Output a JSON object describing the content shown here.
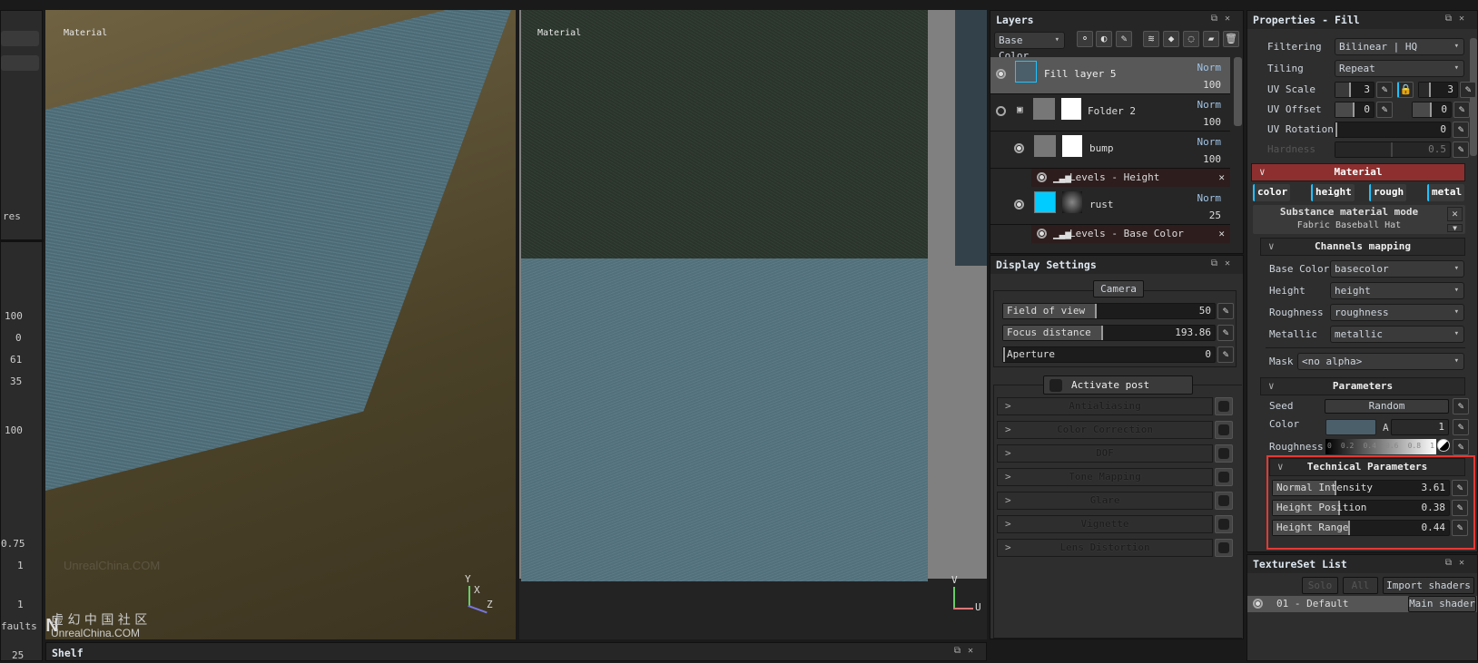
{
  "viewport3d": {
    "label": "Material",
    "watermark": "UnrealChina.COM",
    "axes": [
      "Y",
      "X",
      "Z"
    ]
  },
  "viewport2d": {
    "label": "Material",
    "axes": [
      "V",
      "U"
    ]
  },
  "branding": {
    "logo_text": "UECN",
    "chinese": "虚 幻 中 国 社 区",
    "site": "UnrealChina.COM"
  },
  "shelf": {
    "title": "Shelf"
  },
  "left_panel": {
    "values": [
      "100",
      "0",
      "61",
      "35",
      "100",
      "0.75",
      "1",
      "1",
      "25"
    ],
    "texts": [
      "res",
      "faults"
    ]
  },
  "layers": {
    "title": "Layers",
    "channel": "Base Color",
    "toolbar_icons": [
      "add-particle-icon",
      "add-mask-icon",
      "add-paint-effect-icon",
      "add-layer-icon",
      "add-fill-icon",
      "add-generator-icon",
      "add-folder-icon",
      "delete-icon"
    ],
    "items": [
      {
        "name": "Fill layer 5",
        "blend": "Norm",
        "opacity": "100"
      },
      {
        "name": "Folder 2",
        "blend": "Norm",
        "opacity": "100"
      },
      {
        "name": "bump",
        "blend": "Norm",
        "opacity": "100"
      },
      {
        "name": "rust",
        "blend": "Norm",
        "opacity": "25"
      }
    ],
    "effects": [
      {
        "name": "Levels - Height"
      },
      {
        "name": "Levels - Base Color"
      }
    ]
  },
  "display_settings": {
    "title": "Display Settings",
    "camera_label": "Camera",
    "camera": [
      {
        "label": "Field of view",
        "value": "50",
        "level": 0.44
      },
      {
        "label": "Focus distance",
        "value": "193.86",
        "level": 0.47
      },
      {
        "label": "Aperture",
        "value": "0",
        "level": 0
      }
    ],
    "post_effects_label": "Activate post effects",
    "effects": [
      "Antialiasing",
      "Color Correction",
      "DOF",
      "Tone Mapping",
      "Glare",
      "Vignette",
      "Lens Distortion"
    ]
  },
  "properties": {
    "title": "Properties - Fill",
    "filtering": {
      "label": "Filtering",
      "value": "Bilinear | HQ"
    },
    "tiling": {
      "label": "Tiling",
      "value": "Repeat"
    },
    "uv_scale": {
      "label": "UV Scale",
      "x": "3",
      "y": "3"
    },
    "uv_offset": {
      "label": "UV Offset",
      "x": "0",
      "y": "0"
    },
    "uv_rotation": {
      "label": "UV Rotation",
      "value": "0"
    },
    "hardness": {
      "label": "Hardness",
      "value": "0.5"
    },
    "material": {
      "title": "Material",
      "tabs": [
        "color",
        "height",
        "rough",
        "metal"
      ],
      "mode_title": "Substance material mode",
      "mode_value": "Fabric Baseball Hat",
      "channels_title": "Channels mapping",
      "channels": [
        {
          "label": "Base Color",
          "value": "basecolor"
        },
        {
          "label": "Height",
          "value": "height"
        },
        {
          "label": "Roughness",
          "value": "roughness"
        },
        {
          "label": "Metallic",
          "value": "metallic"
        }
      ],
      "mask": {
        "label": "Mask",
        "value": "<no alpha>"
      },
      "parameters_title": "Parameters",
      "seed": {
        "label": "Seed",
        "button": "Random"
      },
      "color": {
        "label": "Color",
        "swatch": "#4b5f6b",
        "alpha_label": "A",
        "alpha": "1"
      },
      "roughness": {
        "label": "Roughness",
        "ticks": [
          "0",
          "0.2",
          "0.4",
          "0.6",
          "0.8",
          "1"
        ]
      },
      "technical_title": "Technical Parameters",
      "technical": [
        {
          "label": "Normal Intensity",
          "value": "3.61",
          "level": 0.36
        },
        {
          "label": "Height Position",
          "value": "0.38",
          "level": 0.38
        },
        {
          "label": "Height Range",
          "value": "0.44",
          "level": 0.44
        }
      ]
    }
  },
  "textureset": {
    "title": "TextureSet List",
    "buttons": [
      "Solo",
      "All",
      "Import shaders"
    ],
    "items": [
      {
        "name": "01 - Default",
        "shader": "Main shader"
      }
    ]
  },
  "colors": {
    "accent": "#1ec2ff",
    "material_header": "#8e2f2f",
    "highlight_box": "#e53935"
  }
}
